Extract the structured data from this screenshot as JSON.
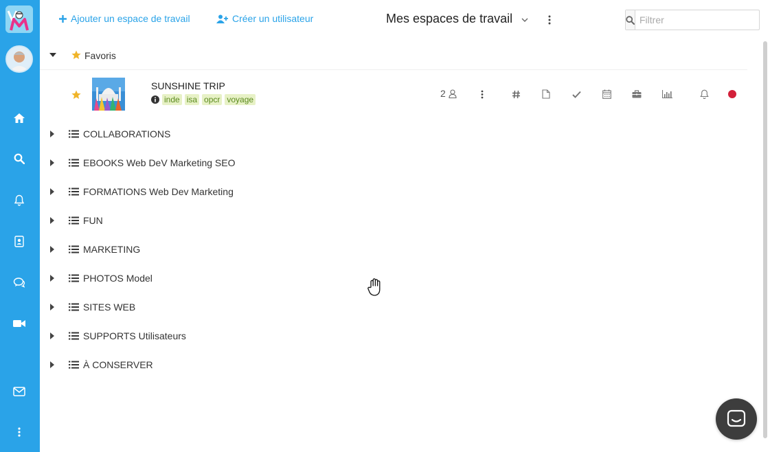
{
  "topbar": {
    "add_workspace": "Ajouter un espace de travail",
    "create_user": "Créer un utilisateur",
    "title": "Mes espaces de travail",
    "filter_placeholder": "Filtrer"
  },
  "favorites": {
    "label": "Favoris",
    "items": [
      {
        "name": "SUNSHINE TRIP",
        "tags": [
          "inde",
          "isa",
          "opcr",
          "voyage"
        ],
        "members": "2"
      }
    ]
  },
  "workspaces": [
    "COLLABORATIONS",
    "EBOOKS Web DeV Marketing SEO",
    "FORMATIONS Web Dev Marketing",
    "FUN",
    "MARKETING",
    "PHOTOS Model",
    "SITES WEB",
    "SUPPORTS Utilisateurs",
    "À CONSERVER"
  ],
  "colors": {
    "sidebar": "#2aa3e8",
    "accent": "#2aa3e8",
    "star": "#f0b429",
    "status_dot": "#d3203a",
    "tag_bg": "#e7f1c6",
    "tag_text": "#5b8a1d"
  },
  "icons": {
    "sidebar": [
      "home-icon",
      "search-icon",
      "bell-icon",
      "contacts-icon",
      "chat-icon",
      "video-icon",
      "mail-icon",
      "more-icon"
    ],
    "row": [
      "kebab-icon",
      "hashtag-icon",
      "file-icon",
      "check-icon",
      "calendar-icon",
      "briefcase-icon",
      "chart-icon",
      "bell-icon",
      "status-dot-icon"
    ]
  }
}
